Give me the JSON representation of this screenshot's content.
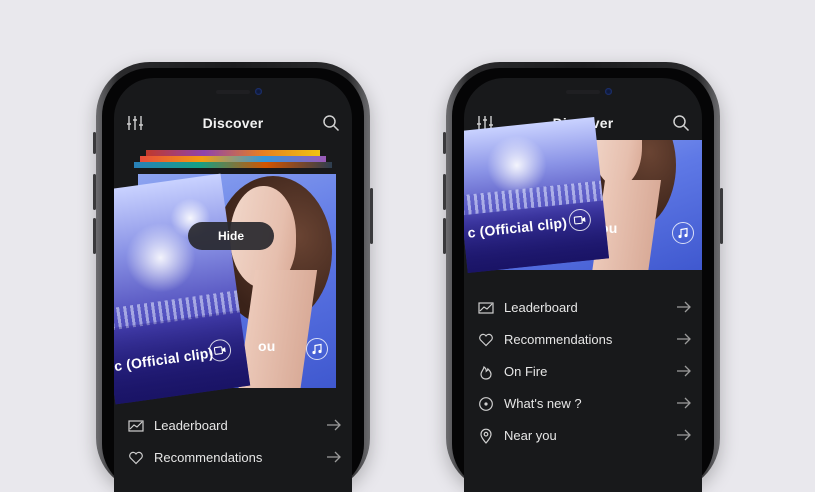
{
  "colors": {
    "background": "#e9e8ed",
    "screen": "#18191b",
    "text": "#e6e6e6",
    "accent_blue": "#5f79e6"
  },
  "left_phone": {
    "header": {
      "title": "Discover",
      "filter_icon": "sliders-icon",
      "search_icon": "search-icon"
    },
    "card": {
      "clip_title": "c (Official clip)",
      "back_text": "ou",
      "hide_label": "Hide"
    },
    "menu": [
      {
        "label": "Leaderboard",
        "icon": "chart-icon"
      },
      {
        "label": "Recommendations",
        "icon": "heart-icon"
      }
    ]
  },
  "right_phone": {
    "header": {
      "title": "Discover",
      "filter_icon": "sliders-icon",
      "search_icon": "search-icon"
    },
    "card": {
      "clip_title": "c (Official clip)",
      "back_text": "ou"
    },
    "menu": [
      {
        "label": "Leaderboard",
        "icon": "chart-icon"
      },
      {
        "label": "Recommendations",
        "icon": "heart-icon"
      },
      {
        "label": "On Fire",
        "icon": "flame-icon"
      },
      {
        "label": "What's new ?",
        "icon": "disc-icon"
      },
      {
        "label": "Near you",
        "icon": "location-pin-icon"
      }
    ]
  }
}
